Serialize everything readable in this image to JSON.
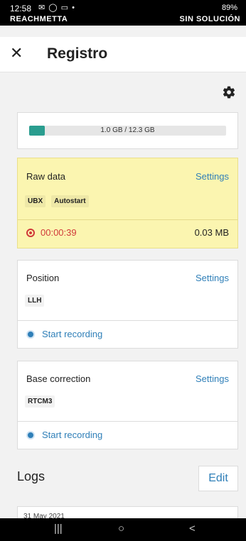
{
  "status_bar": {
    "time": "12:58",
    "notification_icons": "✉ ◯ ▭ •",
    "signal": "89%",
    "device_name": "REACHMETTA",
    "solution_status": "SIN SOLUCIÓN"
  },
  "app_bar": {
    "close_icon": "close-icon",
    "title": "Registro"
  },
  "storage": {
    "used_fraction": 0.08,
    "text": "1.0 GB / 12.3 GB"
  },
  "raw_data": {
    "title": "Raw data",
    "settings_label": "Settings",
    "tags": [
      "UBX",
      "Autostart"
    ],
    "elapsed": "00:00:39",
    "file_size": "0.03 MB"
  },
  "position": {
    "title": "Position",
    "settings_label": "Settings",
    "tags": [
      "LLH"
    ],
    "record_label": "Start recording"
  },
  "base_correction": {
    "title": "Base correction",
    "settings_label": "Settings",
    "tags": [
      "RTCM3"
    ],
    "record_label": "Start recording"
  },
  "logs": {
    "title": "Logs",
    "edit_label": "Edit",
    "first_entry_date": "31 May 2021"
  },
  "nav_bar": {
    "recents": "|||",
    "home": "○",
    "back": "<"
  },
  "colors": {
    "accent": "#2f7fb8",
    "recording_red": "#d03a3a",
    "raw_card_bg": "#fbf5b0",
    "storage_fill": "#2a9d8f"
  }
}
